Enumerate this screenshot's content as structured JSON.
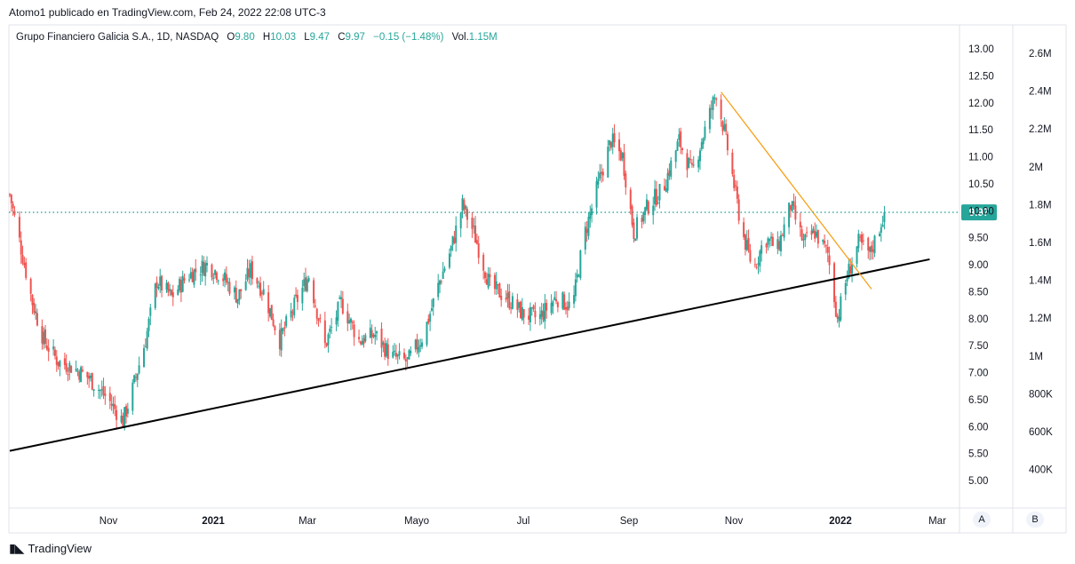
{
  "header": {
    "credit": "Atomo1 publicado en TradingView.com, Feb 24, 2022 22:08 UTC-3"
  },
  "legend": {
    "symbol": "Grupo Financiero Galicia S.A., 1D, NASDAQ",
    "open_label": "O",
    "open": "9.80",
    "high_label": "H",
    "high": "10.03",
    "low_label": "L",
    "low": "9.47",
    "close_label": "C",
    "close": "9.97",
    "change": "−0.15 (−1.48%)",
    "volume_label": "Vol.",
    "volume": "1.15M"
  },
  "footer": {
    "brand": "TradingView",
    "logo_icon": "tradingview-logo-icon"
  },
  "scale_buttons": {
    "auto": "A",
    "second": "B"
  },
  "colors": {
    "up": "#26a69a",
    "down": "#ef5350",
    "current_price_line": "#26a69a",
    "trendline_support": "#000000",
    "trendline_resistance": "#f7a21b"
  },
  "chart_data": {
    "type": "candlestick",
    "title": "Grupo Financiero Galicia S.A., 1D, NASDAQ",
    "price_axis": {
      "ticks": [
        "5.00",
        "5.50",
        "6.00",
        "6.50",
        "7.00",
        "7.50",
        "8.00",
        "8.50",
        "9.00",
        "9.50",
        "10.00",
        "10.50",
        "11.00",
        "11.50",
        "12.00",
        "12.50",
        "13.00"
      ],
      "range": [
        4.6,
        13.4
      ]
    },
    "volume_axis": {
      "ticks": [
        "400K",
        "600K",
        "800K",
        "1M",
        "1.2M",
        "1.4M",
        "1.6M",
        "1.8M",
        "2M",
        "2.2M",
        "2.4M",
        "2.6M"
      ]
    },
    "x_axis": {
      "ticks": [
        "Nov",
        "2021",
        "Mar",
        "Mayo",
        "Jul",
        "Sep",
        "Nov",
        "2022",
        "Mar"
      ],
      "bold_ticks": [
        "2021",
        "2022"
      ]
    },
    "current_price": {
      "value": 9.97,
      "label": "9.97"
    },
    "trendlines": [
      {
        "name": "support",
        "color": "#000000",
        "from": {
          "date": "2020-09-01",
          "price": 5.55
        },
        "to": {
          "date": "2022-03-24",
          "price": 9.1
        }
      },
      {
        "name": "resistance",
        "color": "#f7a21b",
        "from": {
          "date": "2021-11-15",
          "price": 12.2
        },
        "to": {
          "date": "2022-02-16",
          "price": 8.55
        }
      }
    ],
    "price_path": [
      {
        "date": "2020-09-01",
        "close": 10.3
      },
      {
        "date": "2020-09-08",
        "close": 9.3
      },
      {
        "date": "2020-09-15",
        "close": 8.3
      },
      {
        "date": "2020-09-22",
        "close": 7.6
      },
      {
        "date": "2020-10-01",
        "close": 7.2
      },
      {
        "date": "2020-10-10",
        "close": 7.1
      },
      {
        "date": "2020-10-20",
        "close": 6.9
      },
      {
        "date": "2020-11-01",
        "close": 6.5
      },
      {
        "date": "2020-11-10",
        "close": 6.1
      },
      {
        "date": "2020-11-16",
        "close": 6.7
      },
      {
        "date": "2020-11-24",
        "close": 7.6
      },
      {
        "date": "2020-12-01",
        "close": 8.7
      },
      {
        "date": "2020-12-10",
        "close": 8.4
      },
      {
        "date": "2020-12-20",
        "close": 8.8
      },
      {
        "date": "2021-01-01",
        "close": 9.0
      },
      {
        "date": "2021-01-10",
        "close": 8.8
      },
      {
        "date": "2021-01-20",
        "close": 8.4
      },
      {
        "date": "2021-01-28",
        "close": 8.9
      },
      {
        "date": "2021-02-05",
        "close": 8.5
      },
      {
        "date": "2021-02-15",
        "close": 7.6
      },
      {
        "date": "2021-02-25",
        "close": 8.3
      },
      {
        "date": "2021-03-05",
        "close": 8.8
      },
      {
        "date": "2021-03-15",
        "close": 7.5
      },
      {
        "date": "2021-03-25",
        "close": 8.3
      },
      {
        "date": "2021-04-05",
        "close": 7.6
      },
      {
        "date": "2021-04-15",
        "close": 7.7
      },
      {
        "date": "2021-04-25",
        "close": 7.3
      },
      {
        "date": "2021-05-05",
        "close": 7.2
      },
      {
        "date": "2021-05-15",
        "close": 7.7
      },
      {
        "date": "2021-05-25",
        "close": 8.7
      },
      {
        "date": "2021-06-01",
        "close": 9.3
      },
      {
        "date": "2021-06-08",
        "close": 10.1
      },
      {
        "date": "2021-06-15",
        "close": 9.6
      },
      {
        "date": "2021-06-25",
        "close": 8.6
      },
      {
        "date": "2021-07-05",
        "close": 8.4
      },
      {
        "date": "2021-07-15",
        "close": 8.1
      },
      {
        "date": "2021-07-25",
        "close": 8.0
      },
      {
        "date": "2021-08-05",
        "close": 8.4
      },
      {
        "date": "2021-08-15",
        "close": 8.2
      },
      {
        "date": "2021-08-22",
        "close": 9.5
      },
      {
        "date": "2021-09-01",
        "close": 10.6
      },
      {
        "date": "2021-09-08",
        "close": 11.3
      },
      {
        "date": "2021-09-15",
        "close": 11.0
      },
      {
        "date": "2021-09-22",
        "close": 9.6
      },
      {
        "date": "2021-10-01",
        "close": 10.1
      },
      {
        "date": "2021-10-10",
        "close": 10.4
      },
      {
        "date": "2021-10-20",
        "close": 11.3
      },
      {
        "date": "2021-10-28",
        "close": 10.7
      },
      {
        "date": "2021-11-05",
        "close": 11.5
      },
      {
        "date": "2021-11-12",
        "close": 12.2
      },
      {
        "date": "2021-11-20",
        "close": 11.0
      },
      {
        "date": "2021-11-28",
        "close": 9.6
      },
      {
        "date": "2021-12-05",
        "close": 8.9
      },
      {
        "date": "2021-12-12",
        "close": 9.5
      },
      {
        "date": "2021-12-20",
        "close": 9.3
      },
      {
        "date": "2021-12-28",
        "close": 10.1
      },
      {
        "date": "2022-01-05",
        "close": 9.4
      },
      {
        "date": "2022-01-12",
        "close": 9.6
      },
      {
        "date": "2022-01-20",
        "close": 9.2
      },
      {
        "date": "2022-01-26",
        "close": 8.0
      },
      {
        "date": "2022-02-01",
        "close": 8.8
      },
      {
        "date": "2022-02-08",
        "close": 9.4
      },
      {
        "date": "2022-02-15",
        "close": 9.2
      },
      {
        "date": "2022-02-20",
        "close": 9.6
      },
      {
        "date": "2022-02-24",
        "close": 9.97
      }
    ]
  }
}
